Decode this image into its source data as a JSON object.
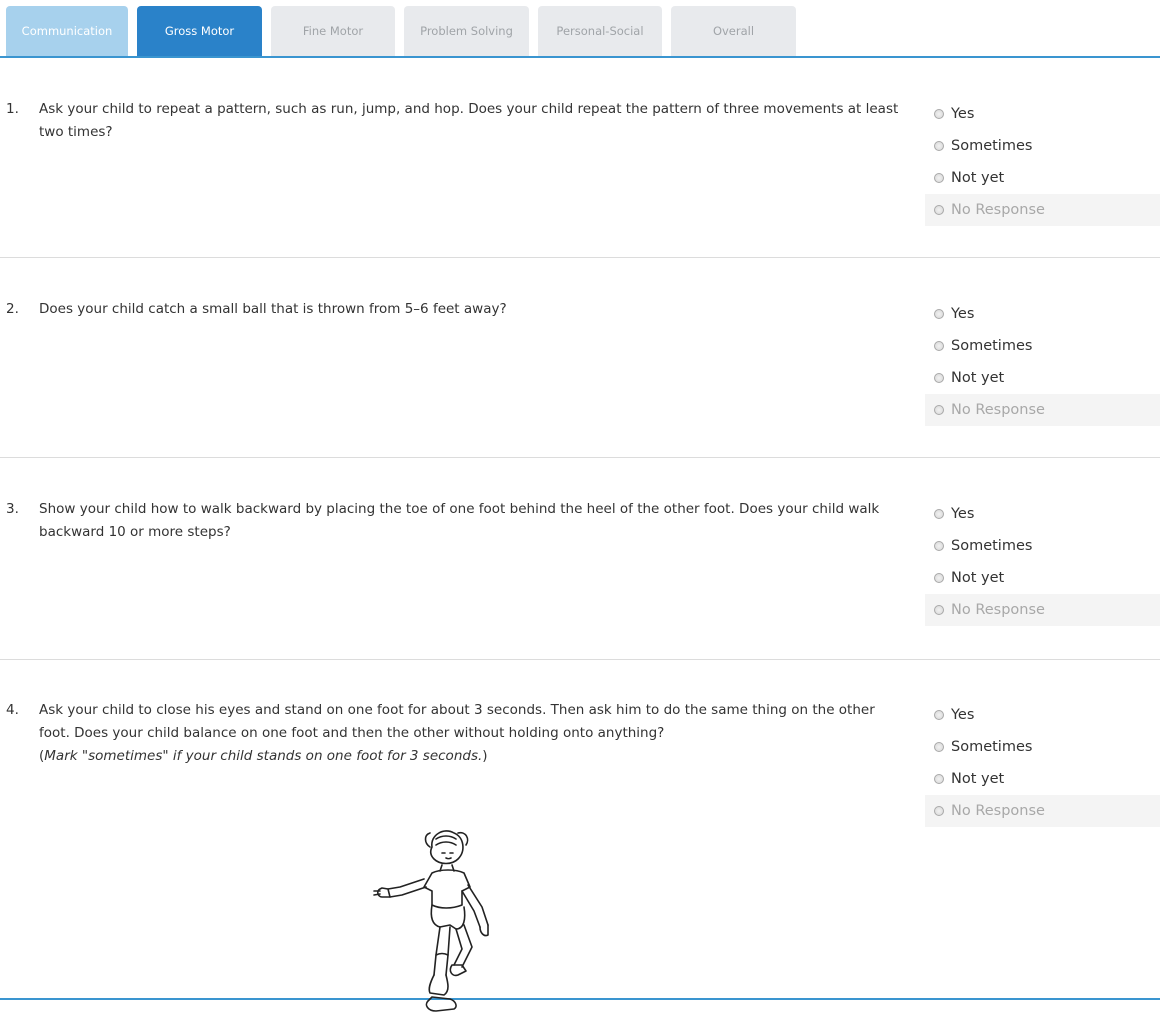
{
  "tabs": [
    {
      "label": "Communication",
      "state": "done"
    },
    {
      "label": "Gross Motor",
      "state": "active"
    },
    {
      "label": "Fine Motor",
      "state": "inactive"
    },
    {
      "label": "Problem Solving",
      "state": "inactive"
    },
    {
      "label": "Personal-Social",
      "state": "inactive"
    },
    {
      "label": "Overall",
      "state": "inactive"
    }
  ],
  "options": [
    "Yes",
    "Sometimes",
    "Not yet",
    "No Response"
  ],
  "questions": [
    {
      "num": "1.",
      "text": "Ask your child to repeat a pattern, such as run, jump, and hop. Does your child repeat the pattern of three movements at least two times?"
    },
    {
      "num": "2.",
      "text": "Does your child catch a small ball that is thrown from 5–6 feet away?"
    },
    {
      "num": "3.",
      "text": "Show your child how to walk backward by placing the toe of one foot behind the heel of the other foot. Does your child walk backward 10 or more steps?"
    },
    {
      "num": "4.",
      "text": "Ask your child to close his eyes and stand on one foot for about 3 seconds. Then ask him to do the same thing on the other foot. Does your child balance on one foot and then the other without holding onto anything?",
      "note_open": "(",
      "note": "Mark \"sometimes\" if your child stands on one foot for 3 seconds.",
      "note_close": ")"
    }
  ],
  "colors": {
    "accent": "#2a82c9",
    "tab_done": "#a7d1ed",
    "tab_inactive": "#e8eaed",
    "divider": "#3a95d0"
  }
}
